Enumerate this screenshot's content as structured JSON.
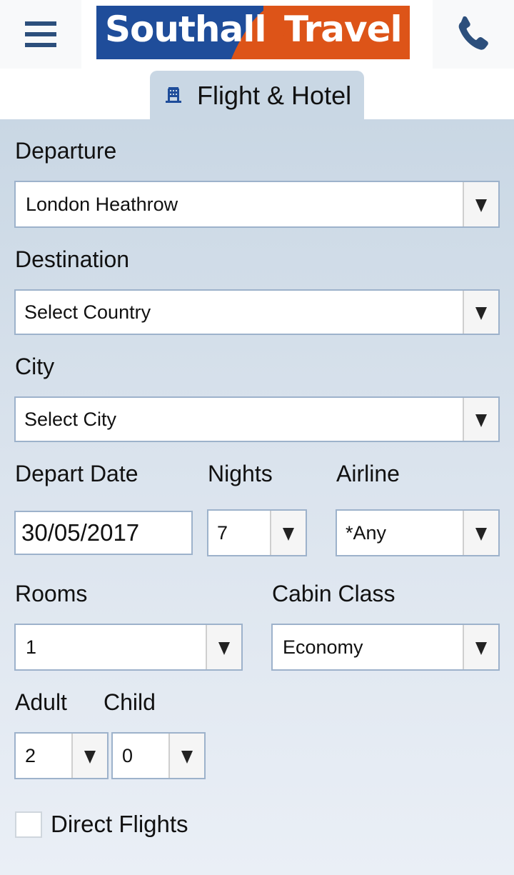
{
  "header": {
    "menu_icon": "hamburger-menu-icon",
    "logo": {
      "part1": "Southall",
      "part2": "Travel",
      "colors": {
        "blue": "#1f4d9a",
        "orange": "#dd5418"
      }
    },
    "phone_icon": "phone-icon",
    "icon_color": "#2c4f7c"
  },
  "tab": {
    "icon": "hotel-building-icon",
    "label": "Flight & Hotel",
    "icon_color": "#1f4d9a"
  },
  "form": {
    "departure": {
      "label": "Departure",
      "value": "London Heathrow"
    },
    "destination": {
      "label": "Destination",
      "value": "Select Country"
    },
    "city": {
      "label": "City",
      "value": "Select City"
    },
    "depart_date": {
      "label": "Depart Date",
      "value": "30/05/2017"
    },
    "nights": {
      "label": "Nights",
      "value": "7"
    },
    "airline": {
      "label": "Airline",
      "value": "*Any"
    },
    "rooms": {
      "label": "Rooms",
      "value": "1"
    },
    "cabin_class": {
      "label": "Cabin Class",
      "value": "Economy"
    },
    "adult": {
      "label": "Adult",
      "value": "2"
    },
    "child": {
      "label": "Child",
      "value": "0"
    },
    "direct_flights": {
      "label": "Direct Flights",
      "checked": false
    }
  }
}
